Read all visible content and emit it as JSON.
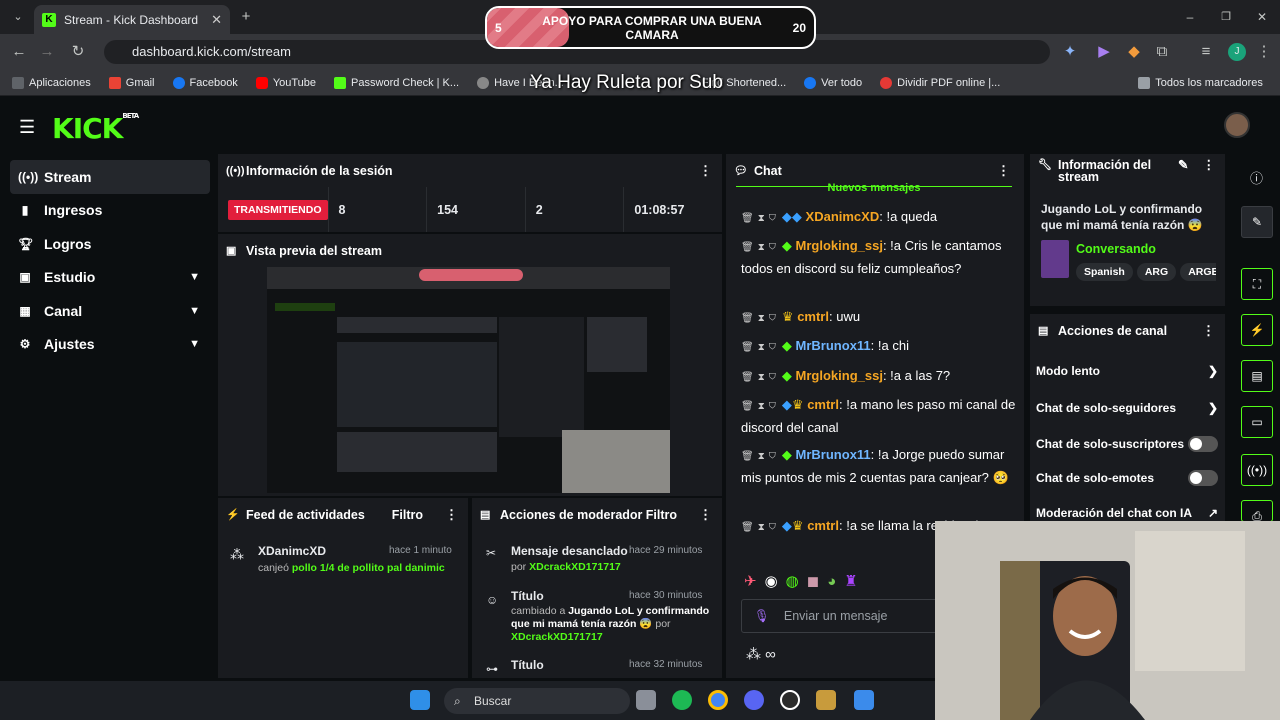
{
  "browser": {
    "tab_title": "Stream - Kick Dashboard",
    "url": "dashboard.kick.com/stream",
    "bookmarks": [
      "Aplicaciones",
      "Gmail",
      "Facebook",
      "YouTube",
      "Password Check | K...",
      "Have I Been...",
      "Find Shortened...",
      "Ver todo",
      "Dividir PDF online |...",
      "Todos los marcadores"
    ]
  },
  "overlay": {
    "goal_start": "5",
    "goal_text": "APOYO PARA COMPRAR UNA BUENA CAMARA",
    "goal_end": "20",
    "goal_progress": 0.25,
    "ruleta_text": "Ya Hay Ruleta por Sub"
  },
  "app": {
    "logo": "KICK",
    "logo_badge": "BETA"
  },
  "sidebar": {
    "items": [
      {
        "label": "Stream",
        "icon": "stream-icon"
      },
      {
        "label": "Ingresos",
        "icon": "bar-chart-icon"
      },
      {
        "label": "Logros",
        "icon": "trophy-icon"
      },
      {
        "label": "Estudio",
        "icon": "studio-icon"
      },
      {
        "label": "Canal",
        "icon": "channel-icon"
      },
      {
        "label": "Ajustes",
        "icon": "gear-icon"
      }
    ]
  },
  "session": {
    "title": "Información de la sesión",
    "status": "TRANSMITIENDO",
    "values": [
      "8",
      "154",
      "2",
      "01:08:57"
    ]
  },
  "preview": {
    "title": "Vista previa del stream"
  },
  "feed": {
    "title": "Feed de actividades",
    "filter": "Filtro",
    "item_user": "XDanimcXD",
    "item_time": "hace 1 minuto",
    "item_action": "canjeó",
    "item_reward": "pollo 1/4 de pollito pal danimic"
  },
  "modactions": {
    "title": "Acciones de moderador",
    "filter": "Filtro",
    "items": [
      {
        "title": "Mensaje desanclado",
        "time": "hace 29 minutos",
        "by": "por",
        "user": "XDcrackXD171717"
      },
      {
        "title": "Título",
        "time": "hace 30 minutos",
        "desc": "cambiado a",
        "value": "Jugando LoL y confirmando que mi mamá tenía razón 😨",
        "by": "por",
        "user": "XDcrackXD171717"
      },
      {
        "title": "Título",
        "time": "hace 32 minutos"
      }
    ]
  },
  "chat": {
    "title": "Chat",
    "new_messages": "Nuevos mensajes",
    "messages": [
      {
        "user": "XDanimcXD",
        "color": "#f5a623",
        "text": ": !a queda"
      },
      {
        "user": "Mrgloking_ssj",
        "color": "#f5a623",
        "text": ": !a Cris le cantamos todos en discord su feliz cumpleaños?"
      },
      {
        "user": "cmtrl",
        "color": "#f5a623",
        "text": ": uwu"
      },
      {
        "user": "MrBrunox11",
        "color": "#6fb6ff",
        "text": ": !a chi"
      },
      {
        "user": "Mrgloking_ssj",
        "color": "#f5a623",
        "text": ": !a a las 7?"
      },
      {
        "user": "cmtrl",
        "color": "#f5a623",
        "text": ": !a mano les paso mi canal de discord del canal"
      },
      {
        "user": "MrBrunox11",
        "color": "#6fb6ff",
        "text": ": !a Jorge puedo sumar mis puntos de mis 2 cuentas para canjear? 🥺"
      },
      {
        "user": "cmtrl",
        "color": "#f5a623",
        "text": ": !a se llama la residencia"
      }
    ],
    "input_placeholder": "Enviar un mensaje",
    "points": "∞"
  },
  "stream_info": {
    "title": "Información del stream",
    "stream_title": "Jugando LoL y confirmando que mi mamá tenía razón 😨",
    "category": "Conversando",
    "tags": [
      "Spanish",
      "ARG",
      "ARGEN"
    ]
  },
  "channel_actions": {
    "title": "Acciones de canal",
    "items": [
      "Modo lento",
      "Chat de solo-seguidores",
      "Chat de solo-suscriptores",
      "Chat de solo-emotes",
      "Moderación del chat con IA"
    ]
  },
  "taskbar": {
    "search": "Buscar"
  },
  "colors": {
    "accent": "#53fc18",
    "live": "#e21e3c",
    "panel": "#191b1f"
  }
}
